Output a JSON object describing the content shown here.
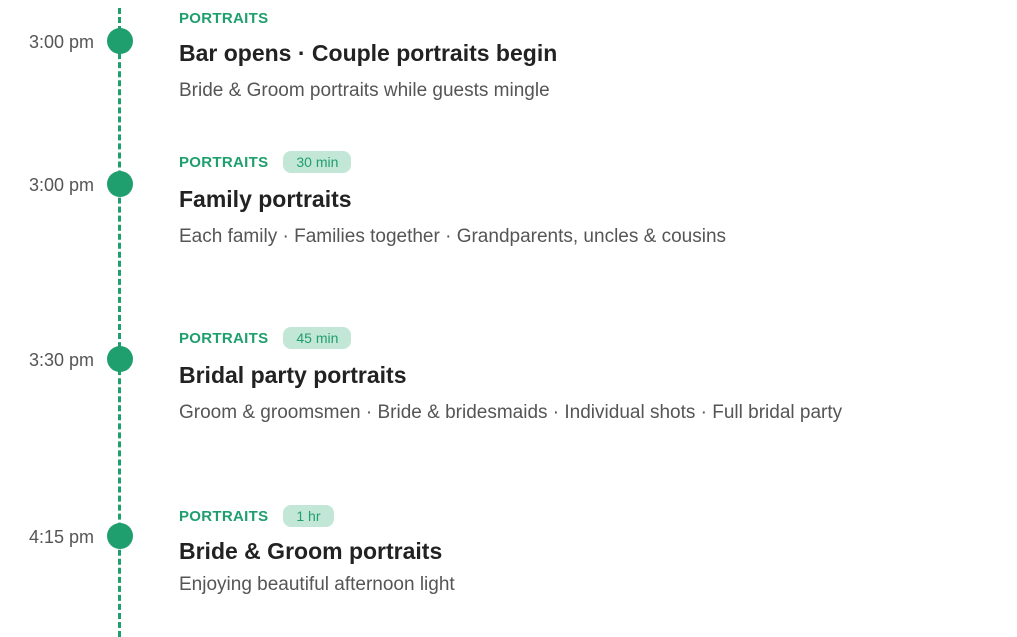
{
  "colors": {
    "accent": "#1f9e6e",
    "badge_bg": "#c3e7d6",
    "title": "#222222",
    "muted": "#555555"
  },
  "events": [
    {
      "time": "3:00 pm",
      "category": "PORTRAITS",
      "duration": "",
      "title": "Bar opens · Couple portraits begin",
      "description": "Bride & Groom portraits while guests mingle"
    },
    {
      "time": "3:00 pm",
      "category": "PORTRAITS",
      "duration": "30 min",
      "title": "Family portraits",
      "description": "Each family · Families together · Grandparents, uncles & cousins"
    },
    {
      "time": "3:30 pm",
      "category": "PORTRAITS",
      "duration": "45 min",
      "title": "Bridal party portraits",
      "description": "Groom & groomsmen · Bride & bridesmaids · Individual shots · Full bridal party"
    },
    {
      "time": "4:15 pm",
      "category": "PORTRAITS",
      "duration": "1 hr",
      "title": "Bride & Groom portraits",
      "description": "Enjoying beautiful afternoon light"
    }
  ]
}
